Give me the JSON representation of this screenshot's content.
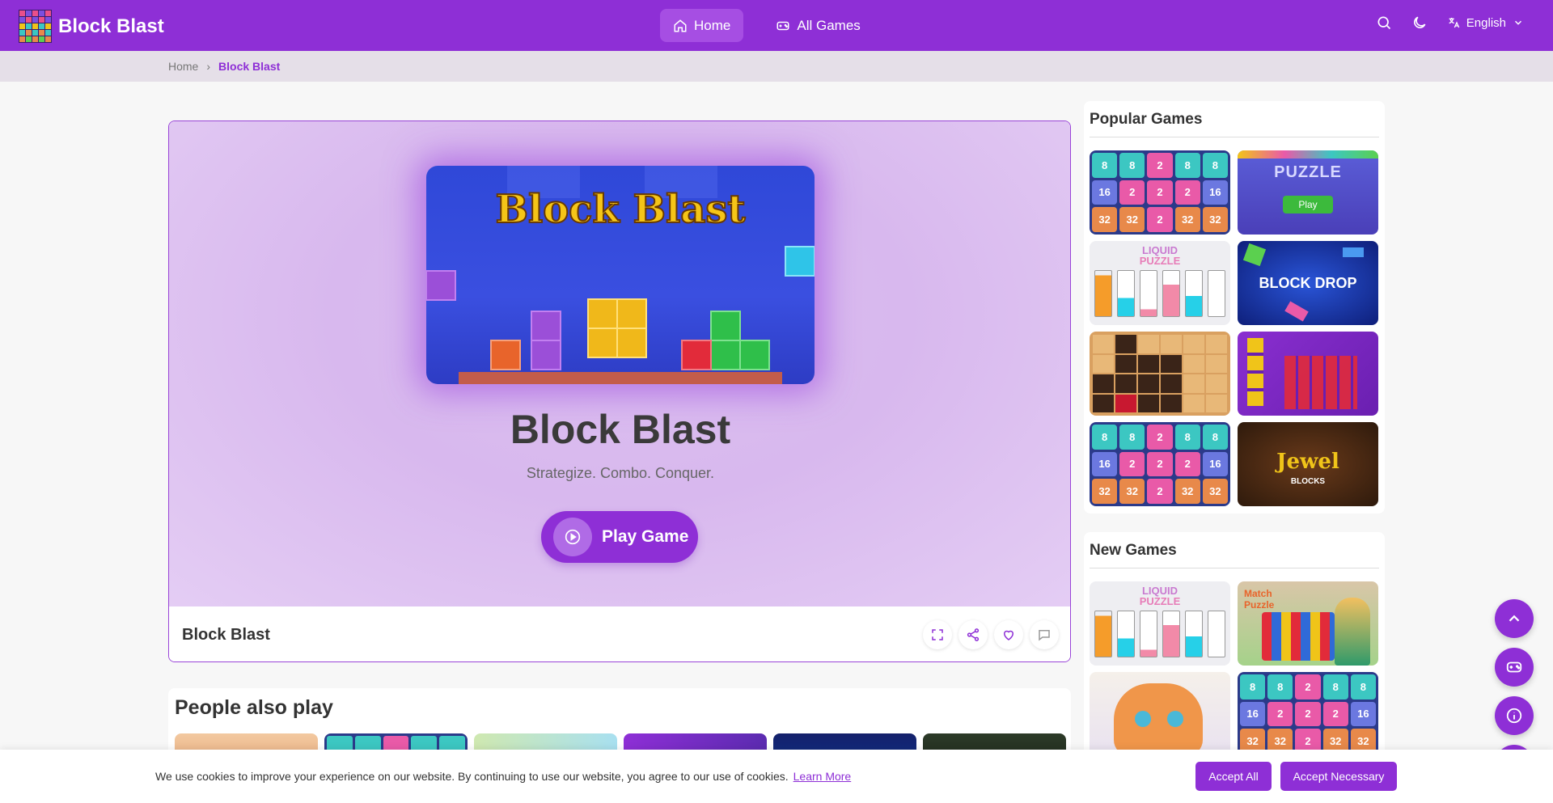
{
  "header": {
    "brand": "Block Blast",
    "nav": [
      {
        "label": "Home",
        "icon": "home-icon",
        "active": true
      },
      {
        "label": "All Games",
        "icon": "gamepad-icon",
        "active": false
      }
    ],
    "language": "English"
  },
  "breadcrumb": {
    "home": "Home",
    "current": "Block Blast"
  },
  "game": {
    "thumb_title": "Block Blast",
    "title": "Block Blast",
    "tagline": "Strategize. Combo. Conquer.",
    "play_label": "Play Game",
    "footer_name": "Block Blast"
  },
  "also_play": {
    "title": "People also play"
  },
  "sidebar": {
    "popular_title": "Popular Games",
    "new_title": "New Games",
    "popular_tiles": {
      "puzzle_text": "PUZZLE",
      "puzzle_play": "Play",
      "liquid": "LIQUID",
      "liquid_sub": "PUZZLE",
      "block_drop": "BLOCK DROP",
      "jewel": "Jewel",
      "jewel_sub": "BLOCKS"
    },
    "new_tiles": {
      "liquid": "LIQUID",
      "liquid_sub": "PUZZLE",
      "match": "Match Puzzle"
    },
    "number_tile": {
      "row1": [
        "8",
        "8",
        "2",
        "8",
        "8"
      ],
      "row2": [
        "16",
        "2",
        "2",
        "2",
        "16"
      ],
      "row3": [
        "32",
        "32",
        "2",
        "32",
        "32"
      ]
    }
  },
  "cookie": {
    "text": "We use cookies to improve your experience on our website. By continuing to use our website, you agree to our use of cookies.",
    "learn_more": "Learn More",
    "accept_all": "Accept All",
    "accept_necessary": "Accept Necessary"
  },
  "colors": {
    "brand": "#8e2fd6",
    "stage": "#d8b8ee"
  }
}
